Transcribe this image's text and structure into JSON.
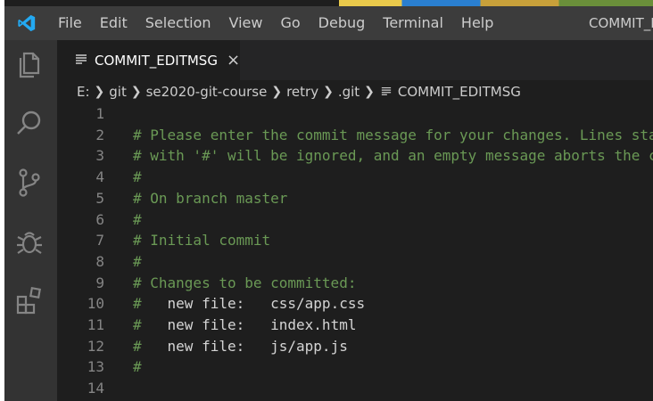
{
  "window": {
    "title": "COMMIT_E"
  },
  "menu": [
    "File",
    "Edit",
    "Selection",
    "View",
    "Go",
    "Debug",
    "Terminal",
    "Help"
  ],
  "activity_bar": [
    "files-icon",
    "search-icon",
    "source-control-icon",
    "debug-icon",
    "extensions-icon"
  ],
  "tab": {
    "label": "COMMIT_EDITMSG",
    "close": "×"
  },
  "breadcrumb": {
    "items": [
      "E:",
      "git",
      "se2020-git-course",
      "retry",
      ".git"
    ],
    "file": "COMMIT_EDITMSG"
  },
  "editor": {
    "lines": [
      {
        "n": "1",
        "text": "",
        "kind": "plain"
      },
      {
        "n": "2",
        "text": "# Please enter the commit message for your changes. Lines starting",
        "kind": "comment"
      },
      {
        "n": "3",
        "text": "# with '#' will be ignored, and an empty message aborts the commit.",
        "kind": "comment"
      },
      {
        "n": "4",
        "text": "#",
        "kind": "comment"
      },
      {
        "n": "5",
        "text": "# On branch master",
        "kind": "comment"
      },
      {
        "n": "6",
        "text": "#",
        "kind": "comment"
      },
      {
        "n": "7",
        "text": "# Initial commit",
        "kind": "comment"
      },
      {
        "n": "8",
        "text": "#",
        "kind": "comment"
      },
      {
        "n": "9",
        "text": "# Changes to be committed:",
        "kind": "comment"
      },
      {
        "n": "10",
        "text": "#",
        "kind": "comment",
        "rest": "   new file:   css/app.css"
      },
      {
        "n": "11",
        "text": "#",
        "kind": "comment",
        "rest": "   new file:   index.html"
      },
      {
        "n": "12",
        "text": "#",
        "kind": "comment",
        "rest": "   new file:   js/app.js"
      },
      {
        "n": "13",
        "text": "#",
        "kind": "comment"
      },
      {
        "n": "14",
        "text": "",
        "kind": "plain"
      }
    ]
  },
  "colors": {
    "comment": "#6a9955",
    "accent": "#23a9f2"
  }
}
